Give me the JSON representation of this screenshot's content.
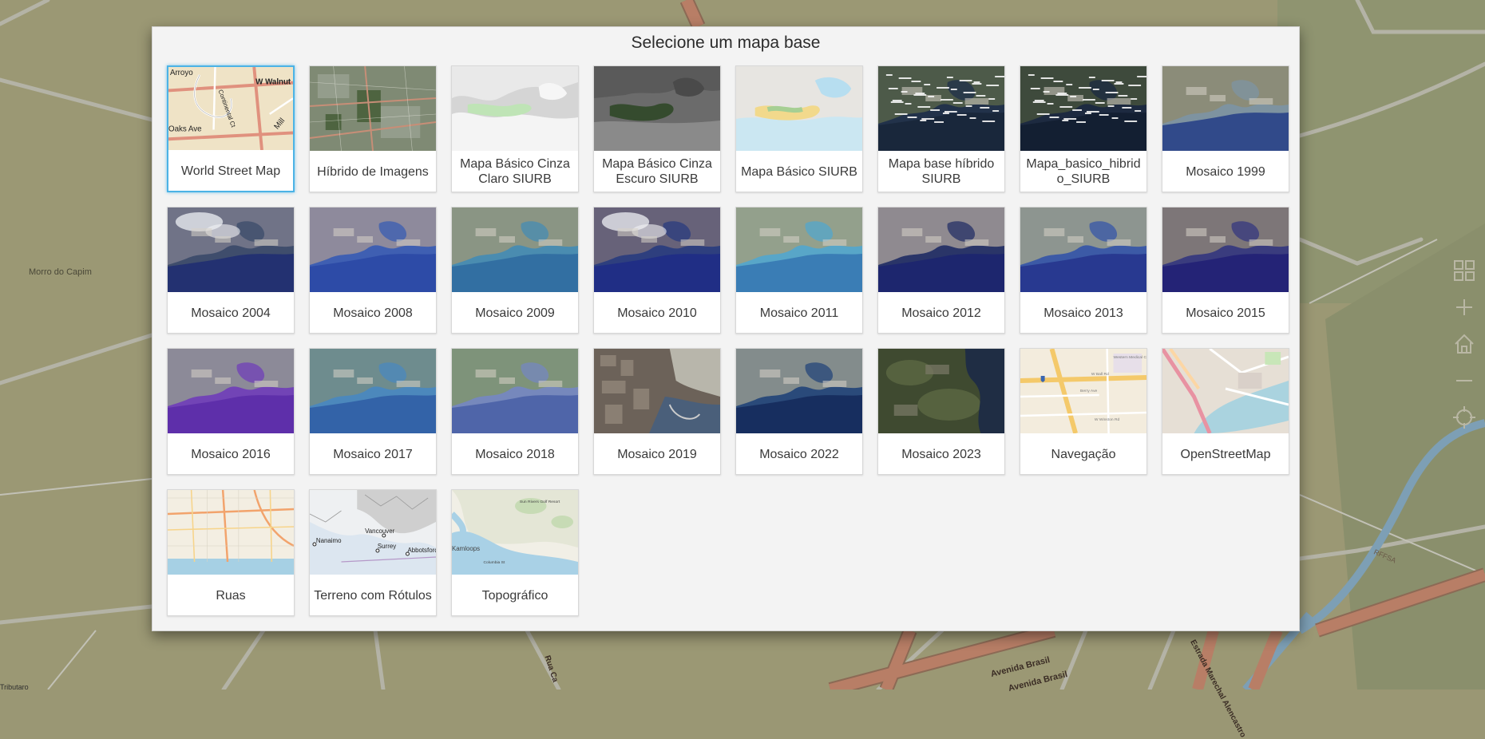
{
  "dialog": {
    "title": "Selecione um mapa base"
  },
  "selected_basemap": "World Street Map",
  "basemaps": [
    {
      "label": "World Street Map",
      "thumb": "street"
    },
    {
      "label": "Híbrido de Imagens",
      "thumb": "hybrid"
    },
    {
      "label": "Mapa Básico Cinza Claro SIURB",
      "thumb": "lightgray"
    },
    {
      "label": "Mapa Básico Cinza Escuro SIURB",
      "thumb": "darkgray"
    },
    {
      "label": "Mapa Básico SIURB",
      "thumb": "siurb"
    },
    {
      "label": "Mapa base híbrido SIURB",
      "thumb": "sat-dark-labels"
    },
    {
      "label": "Mapa_basico_hibrido_SIURB",
      "thumb": "sat-dark-labels2"
    },
    {
      "label": "Mosaico 1999",
      "thumb": "sat-a"
    },
    {
      "label": "Mosaico 2004",
      "thumb": "sat-cloud"
    },
    {
      "label": "Mosaico 2008",
      "thumb": "sat-purple"
    },
    {
      "label": "Mosaico 2009",
      "thumb": "sat-teal"
    },
    {
      "label": "Mosaico 2010",
      "thumb": "sat-cloud2"
    },
    {
      "label": "Mosaico 2011",
      "thumb": "sat-teal2"
    },
    {
      "label": "Mosaico 2012",
      "thumb": "sat-navy"
    },
    {
      "label": "Mosaico 2013",
      "thumb": "sat-blue"
    },
    {
      "label": "Mosaico 2015",
      "thumb": "sat-violet"
    },
    {
      "label": "Mosaico 2016",
      "thumb": "sat-purple2"
    },
    {
      "label": "Mosaico 2017",
      "thumb": "sat-aqua"
    },
    {
      "label": "Mosaico 2018",
      "thumb": "sat-green"
    },
    {
      "label": "Mosaico 2019",
      "thumb": "city"
    },
    {
      "label": "Mosaico 2022",
      "thumb": "sat-navy2"
    },
    {
      "label": "Mosaico 2023",
      "thumb": "sat-forest"
    },
    {
      "label": "Navegação",
      "thumb": "navigation"
    },
    {
      "label": "OpenStreetMap",
      "thumb": "osm"
    },
    {
      "label": "Ruas",
      "thumb": "streets"
    },
    {
      "label": "Terreno com Rótulos",
      "thumb": "terrain"
    },
    {
      "label": "Topográfico",
      "thumb": "topo"
    }
  ],
  "thumb_text": {
    "street": [
      "Arroyo",
      "W Walnut",
      "Continental Ct",
      "Oaks Ave",
      "Mill"
    ],
    "terrain": [
      "Vancouver",
      "Nanaimo",
      "Surrey",
      "Abbotsford"
    ],
    "topo": [
      "Kamloops",
      "Sun Rivers Golf Resort",
      "Columbia St"
    ],
    "navigation": [
      "W Ball Rd",
      "Western Medical Center Anaheim",
      "Berry Ave",
      "W Winston Rd"
    ]
  },
  "map": {
    "place_label": "Morro do Capim",
    "road_labels": [
      "Avenida Brasil",
      "Avenida Brasil",
      "Estrada Marechal Alencastro",
      "RFFSA",
      "Rua Ca"
    ],
    "corner_label": "Tributaro"
  },
  "controls": [
    {
      "name": "basemap-gallery-button",
      "icon": "grid-icon"
    },
    {
      "name": "zoom-in-button",
      "icon": "plus-icon"
    },
    {
      "name": "home-button",
      "icon": "home-icon"
    },
    {
      "name": "zoom-out-button",
      "icon": "minus-icon"
    },
    {
      "name": "locate-button",
      "icon": "crosshair-icon"
    }
  ],
  "colors": {
    "map_bg": "#9a9774",
    "road_fill": "#b07a62",
    "dialog_bg": "#f3f3f3",
    "selected_border": "#4cb3e6"
  }
}
